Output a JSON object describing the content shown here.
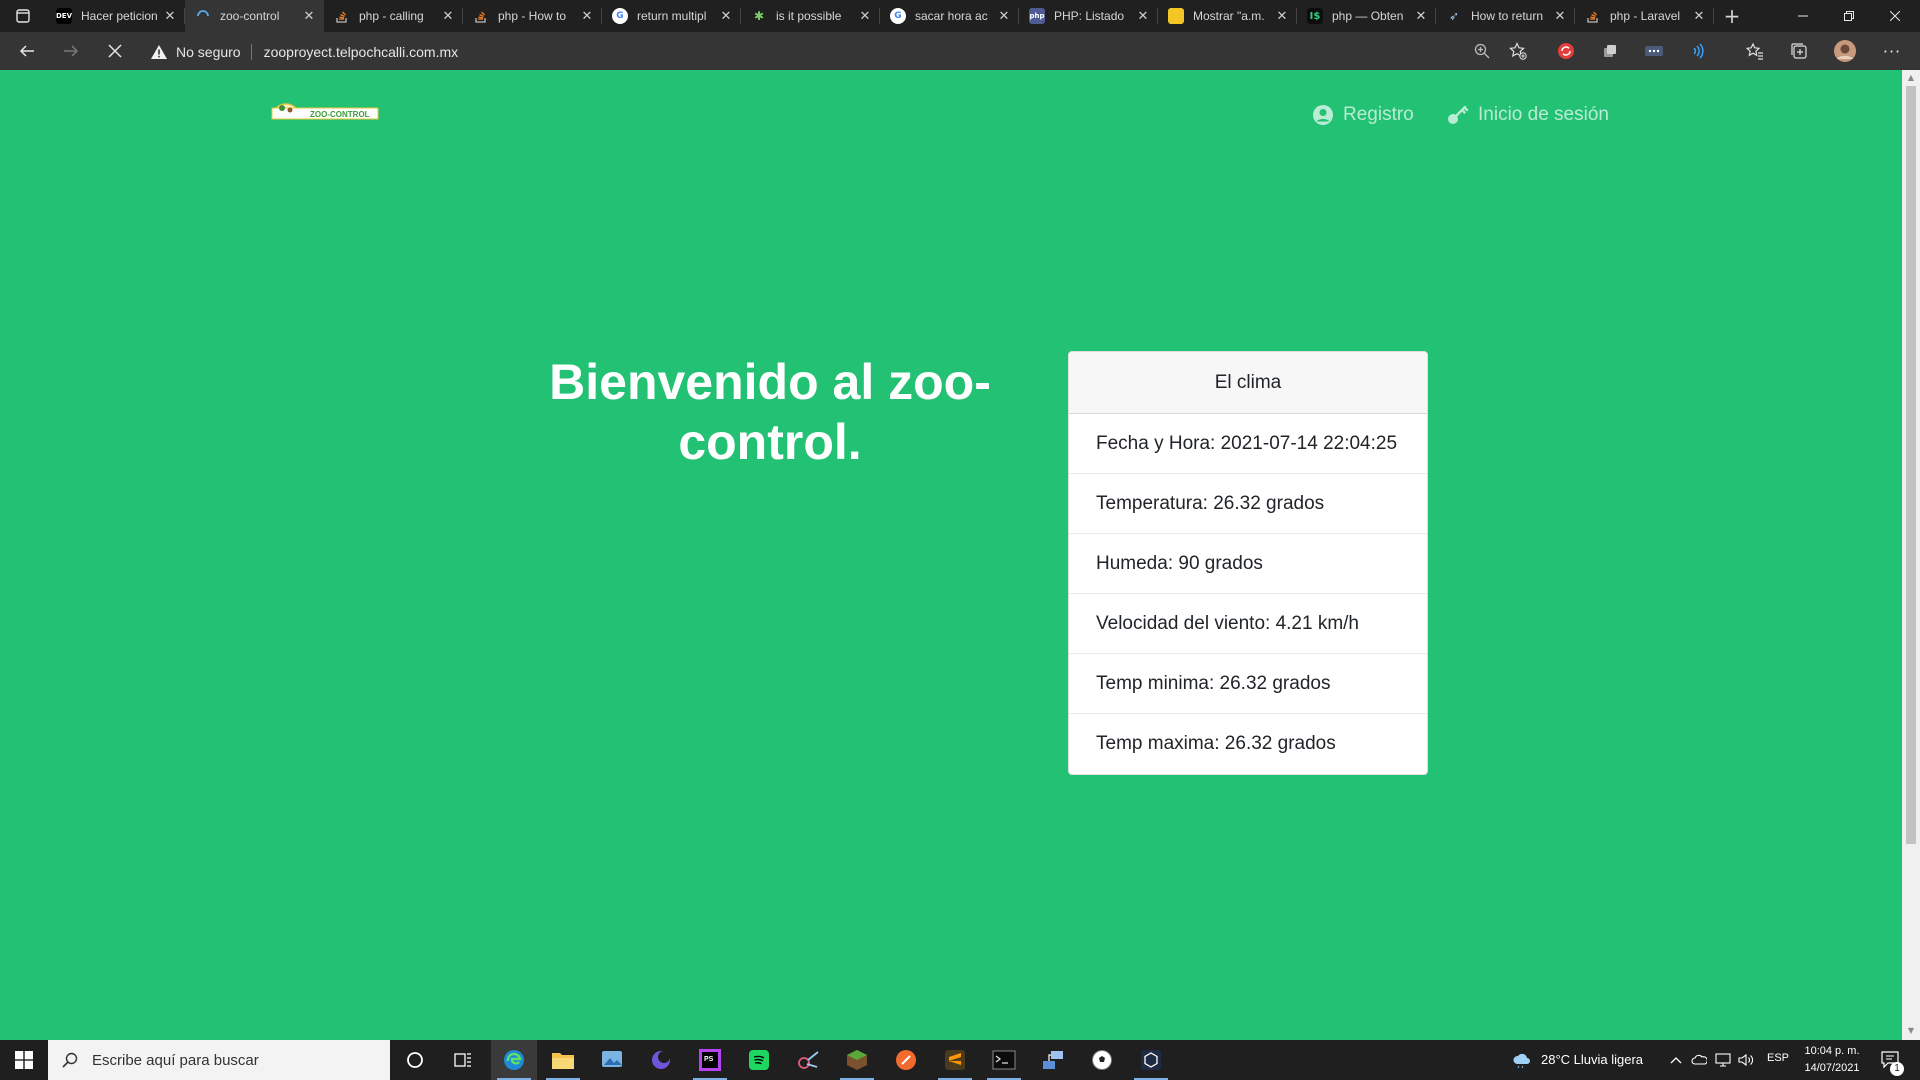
{
  "browser": {
    "tabs": [
      {
        "title": "Hacer peticion",
        "favicon": "DEV",
        "favicon_color": "#000000"
      },
      {
        "title": "zoo-control",
        "favicon": "",
        "favicon_color": "#353535",
        "active": true
      },
      {
        "title": "php - calling",
        "favicon": "",
        "favicon_color": "#f48024"
      },
      {
        "title": "php - How to",
        "favicon": "",
        "favicon_color": "#f48024"
      },
      {
        "title": "return multipl",
        "favicon": "G",
        "favicon_color": "#ffffff"
      },
      {
        "title": "is it possible",
        "favicon": "",
        "favicon_color": "#2b2b2b"
      },
      {
        "title": "sacar hora ac",
        "favicon": "G",
        "favicon_color": "#ffffff"
      },
      {
        "title": "PHP: Listado",
        "favicon": "php",
        "favicon_color": "#4f5b93"
      },
      {
        "title": "Mostrar \"a.m.",
        "favicon": "",
        "favicon_color": "#f3c623"
      },
      {
        "title": "php — Obten",
        "favicon": "",
        "favicon_color": "#0d0d0d"
      },
      {
        "title": "How to return",
        "favicon": "",
        "favicon_color": "#2b2b2b"
      },
      {
        "title": "php - Laravel",
        "favicon": "",
        "favicon_color": "#f48024"
      }
    ],
    "security_label": "No seguro",
    "url": "zooproyect.telpochcalli.com.mx"
  },
  "site": {
    "logo_text": "ZOO-CONTROL",
    "nav": {
      "register": "Registro",
      "login": "Inicio de sesión"
    },
    "hero_title": "Bienvenido al zoo-control.",
    "weather": {
      "title": "El clima",
      "rows": [
        "Fecha y Hora: 2021-07-14 22:04:25",
        "Temperatura: 26.32 grados",
        "Humeda: 90 grados",
        "Velocidad del viento: 4.21 km/h",
        "Temp minima: 26.32 grados",
        "Temp maxima: 26.32 grados"
      ]
    }
  },
  "taskbar": {
    "search_placeholder": "Escribe aquí para buscar",
    "weather": "28°C  Lluvia ligera",
    "language": "ESP",
    "time": "10:04 p. m.",
    "date": "14/07/2021",
    "notifications": "1"
  },
  "colors": {
    "page_background": "#22c174",
    "nav_text": "#b9ecd2"
  }
}
